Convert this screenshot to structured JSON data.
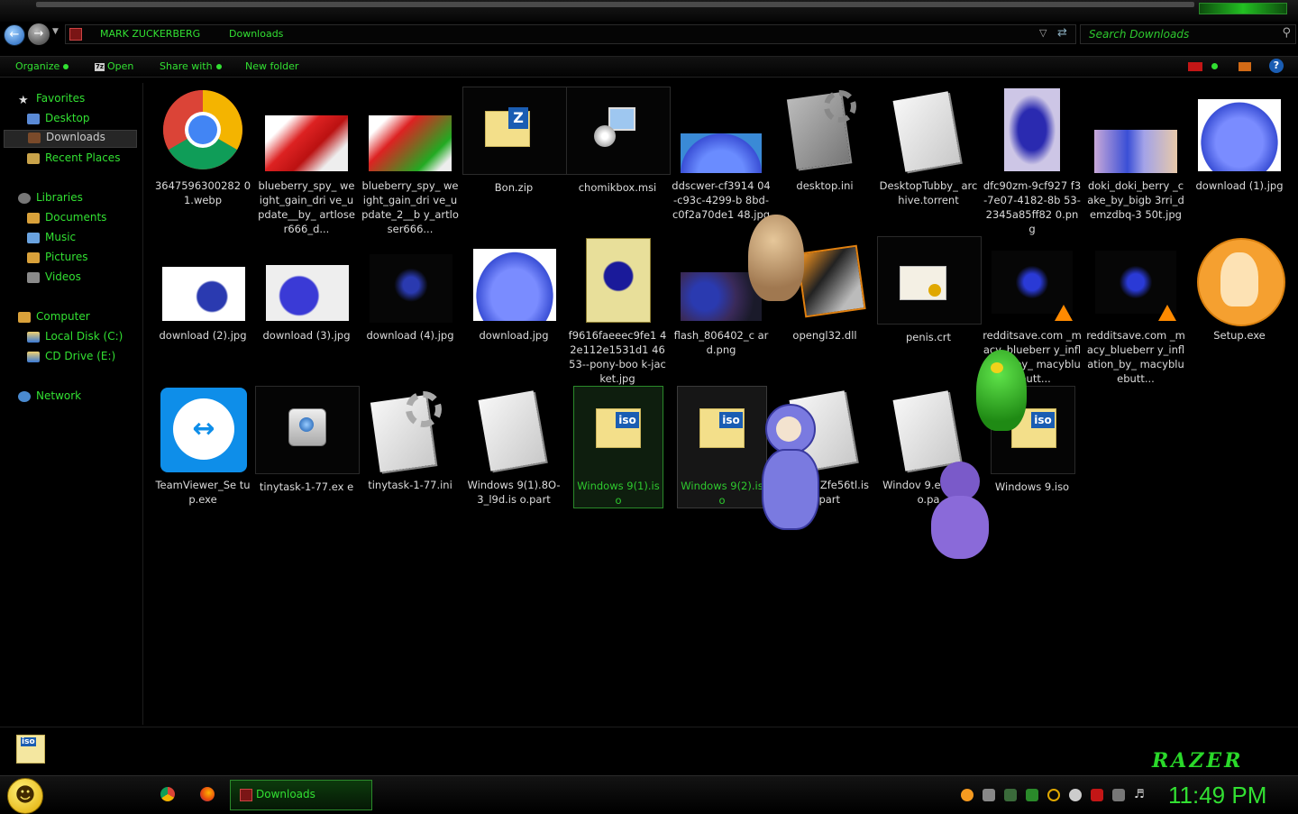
{
  "address": {
    "crumbs": [
      "MARK ZUCKERBERG",
      "Downloads"
    ]
  },
  "search": {
    "placeholder": "Search Downloads"
  },
  "toolbar": {
    "organize": "Organize",
    "open": "Open",
    "share_with": "Share with",
    "new_folder": "New folder",
    "help": "?"
  },
  "sidebar": {
    "favorites": "Favorites",
    "desktop": "Desktop",
    "downloads": "Downloads",
    "recent_places": "Recent Places",
    "libraries": "Libraries",
    "documents": "Documents",
    "music": "Music",
    "pictures": "Pictures",
    "videos": "Videos",
    "computer": "Computer",
    "local_disk": "Local Disk (C:)",
    "cd_drive": "CD Drive (E:)",
    "network": "Network"
  },
  "files": [
    {
      "name": "3647596300282 01.webp",
      "icon": "chrome-icon"
    },
    {
      "name": "blueberry_spy_ weight_gain_dri ve_update__by_ artloser666_d...",
      "icon": "image-thumbnail"
    },
    {
      "name": "blueberry_spy_ weight_gain_dri ve_update_2__b y_artloser666...",
      "icon": "image-thumbnail"
    },
    {
      "name": "Bon.zip",
      "icon": "zip-folder-icon"
    },
    {
      "name": "chomikbox.msi",
      "icon": "installer-icon"
    },
    {
      "name": "ddscwer-cf3914 04-c93c-4299-b 8bd-c0f2a70de1 48.jpg",
      "icon": "image-thumbnail"
    },
    {
      "name": "desktop.ini",
      "icon": "settings-file-icon"
    },
    {
      "name": "DesktopTubby_ archive.torrent",
      "icon": "document-icon"
    },
    {
      "name": "dfc90zm-9cf927 f3-7e07-4182-8b 53-2345a85ff82 0.png",
      "icon": "image-thumbnail"
    },
    {
      "name": "doki_doki_berry _cake_by_bigb 3rri_demzdbq-3 50t.jpg",
      "icon": "image-thumbnail"
    },
    {
      "name": "download (1).jpg",
      "icon": "image-thumbnail"
    },
    {
      "name": "download (2).jpg",
      "icon": "image-thumbnail"
    },
    {
      "name": "download (3).jpg",
      "icon": "image-thumbnail"
    },
    {
      "name": "download (4).jpg",
      "icon": "image-thumbnail"
    },
    {
      "name": "download.jpg",
      "icon": "image-thumbnail"
    },
    {
      "name": "f9616faeeec9fe1 42e112e1531d1 4653--pony-boo k-jacket.jpg",
      "icon": "image-thumbnail"
    },
    {
      "name": "flash_806402_c ard.png",
      "icon": "image-thumbnail"
    },
    {
      "name": "opengl32.dll",
      "icon": "dll-icon"
    },
    {
      "name": "penis.crt",
      "icon": "certificate-icon"
    },
    {
      "name": "redditsave.com _macy_blueberr y_inflation_by_ macybluebutt...",
      "icon": "video-thumbnail"
    },
    {
      "name": "redditsave.com _macy_blueberr y_inflation_by_ macybluebutt...",
      "icon": "video-thumbnail"
    },
    {
      "name": "Setup.exe",
      "icon": "setup-icon"
    },
    {
      "name": "TeamViewer_Se tup.exe",
      "icon": "teamviewer-icon"
    },
    {
      "name": "tinytask-1-77.ex e",
      "icon": "app-icon"
    },
    {
      "name": "tinytask-1-77.ini",
      "icon": "settings-file-icon"
    },
    {
      "name": "Windows 9(1).8O-3_l9d.is o.part",
      "icon": "document-icon"
    },
    {
      "name": "Windows 9(1).iso",
      "icon": "iso-icon"
    },
    {
      "name": "Windows 9(2).iso",
      "icon": "iso-icon"
    },
    {
      "name": "indows Zfe56tl.is o.part",
      "icon": "document-icon"
    },
    {
      "name": "Windov 9.emDDU o.pa",
      "icon": "document-icon"
    },
    {
      "name": "Windows 9.iso",
      "icon": "iso-icon"
    }
  ],
  "status": {
    "brand": "RAZER"
  },
  "taskbar": {
    "active_window": "Downloads",
    "clock": "11:49 PM"
  }
}
